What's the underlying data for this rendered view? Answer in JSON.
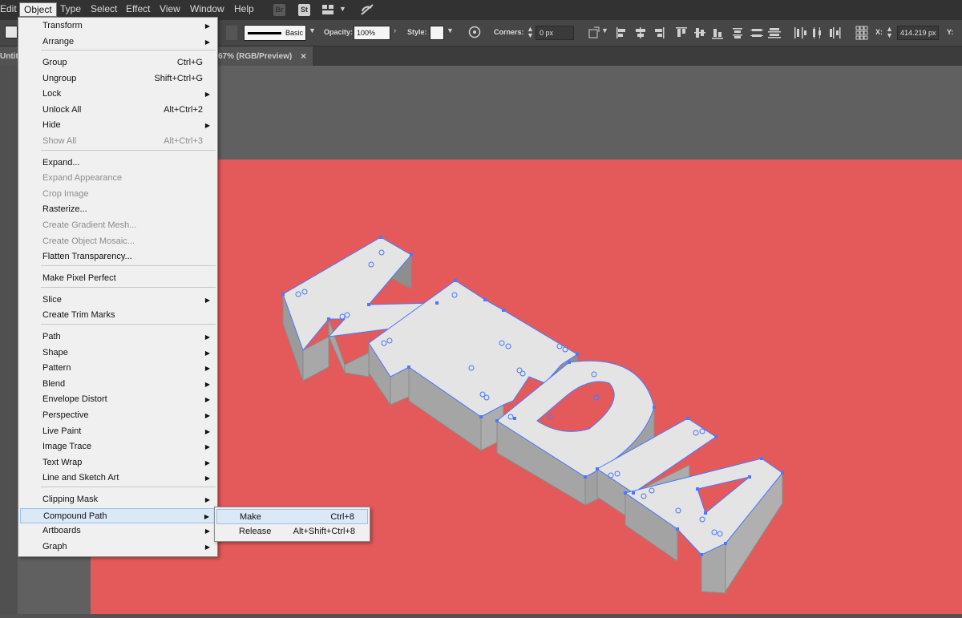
{
  "menubar": {
    "items": [
      "Edit",
      "Object",
      "Type",
      "Select",
      "Effect",
      "View",
      "Window",
      "Help"
    ],
    "bridge_label": "Br",
    "stock_label": "St"
  },
  "controlbar": {
    "stroke_style": "Basic",
    "opacity_label": "Opacity:",
    "opacity_value": "100%",
    "style_label": "Style:",
    "corners_label": "Corners:",
    "corners_value": "0 px",
    "x_label": "X:",
    "x_value": "414.219 px",
    "y_label": "Y:"
  },
  "document_tab": {
    "name_fragment": "Untitl",
    "mode": "67% (RGB/Preview)",
    "close": "×"
  },
  "object_menu": {
    "items": [
      {
        "label": "Transform",
        "shortcut": "",
        "submenu": true,
        "disabled": false
      },
      {
        "label": "Arrange",
        "shortcut": "",
        "submenu": true,
        "disabled": false
      },
      {
        "label": "Group",
        "shortcut": "Ctrl+G",
        "submenu": false,
        "disabled": false
      },
      {
        "label": "Ungroup",
        "shortcut": "Shift+Ctrl+G",
        "submenu": false,
        "disabled": false
      },
      {
        "label": "Lock",
        "shortcut": "",
        "submenu": true,
        "disabled": false
      },
      {
        "label": "Unlock All",
        "shortcut": "Alt+Ctrl+2",
        "submenu": false,
        "disabled": false
      },
      {
        "label": "Hide",
        "shortcut": "",
        "submenu": true,
        "disabled": false
      },
      {
        "label": "Show All",
        "shortcut": "Alt+Ctrl+3",
        "submenu": false,
        "disabled": true
      },
      {
        "label": "Expand...",
        "shortcut": "",
        "submenu": false,
        "disabled": false
      },
      {
        "label": "Expand Appearance",
        "shortcut": "",
        "submenu": false,
        "disabled": true
      },
      {
        "label": "Crop Image",
        "shortcut": "",
        "submenu": false,
        "disabled": true
      },
      {
        "label": "Rasterize...",
        "shortcut": "",
        "submenu": false,
        "disabled": false
      },
      {
        "label": "Create Gradient Mesh...",
        "shortcut": "",
        "submenu": false,
        "disabled": true
      },
      {
        "label": "Create Object Mosaic...",
        "shortcut": "",
        "submenu": false,
        "disabled": true
      },
      {
        "label": "Flatten Transparency...",
        "shortcut": "",
        "submenu": false,
        "disabled": false
      },
      {
        "label": "Make Pixel Perfect",
        "shortcut": "",
        "submenu": false,
        "disabled": false
      },
      {
        "label": "Slice",
        "shortcut": "",
        "submenu": true,
        "disabled": false
      },
      {
        "label": "Create Trim Marks",
        "shortcut": "",
        "submenu": false,
        "disabled": false
      },
      {
        "label": "Path",
        "shortcut": "",
        "submenu": true,
        "disabled": false
      },
      {
        "label": "Shape",
        "shortcut": "",
        "submenu": true,
        "disabled": false
      },
      {
        "label": "Pattern",
        "shortcut": "",
        "submenu": true,
        "disabled": false
      },
      {
        "label": "Blend",
        "shortcut": "",
        "submenu": true,
        "disabled": false
      },
      {
        "label": "Envelope Distort",
        "shortcut": "",
        "submenu": true,
        "disabled": false
      },
      {
        "label": "Perspective",
        "shortcut": "",
        "submenu": true,
        "disabled": false
      },
      {
        "label": "Live Paint",
        "shortcut": "",
        "submenu": true,
        "disabled": false
      },
      {
        "label": "Image Trace",
        "shortcut": "",
        "submenu": true,
        "disabled": false
      },
      {
        "label": "Text Wrap",
        "shortcut": "",
        "submenu": true,
        "disabled": false
      },
      {
        "label": "Line and Sketch Art",
        "shortcut": "",
        "submenu": true,
        "disabled": false
      },
      {
        "label": "Clipping Mask",
        "shortcut": "",
        "submenu": true,
        "disabled": false
      },
      {
        "label": "Compound Path",
        "shortcut": "",
        "submenu": true,
        "disabled": false,
        "highlighted": true
      },
      {
        "label": "Artboards",
        "shortcut": "",
        "submenu": true,
        "disabled": false
      },
      {
        "label": "Graph",
        "shortcut": "",
        "submenu": true,
        "disabled": false
      }
    ]
  },
  "compound_path_submenu": {
    "items": [
      {
        "label": "Make",
        "shortcut": "Ctrl+8"
      },
      {
        "label": "Release",
        "shortcut": "Alt+Shift+Ctrl+8"
      }
    ]
  },
  "artwork": {
    "letters": [
      "M",
      "E",
      "D",
      "I",
      "A"
    ],
    "background_color": "#e45a5b",
    "face_color": "#e4e4e4",
    "side_color": "#9b9b9b",
    "selection_color": "#4a78ff"
  }
}
